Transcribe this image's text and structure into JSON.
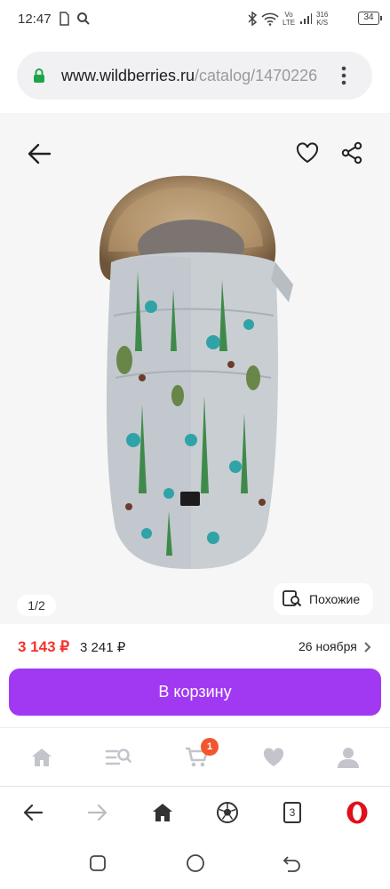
{
  "status_bar": {
    "time": "12:47",
    "network_label_top": "Vo",
    "network_label_bottom": "LTE",
    "speed_top": "316",
    "speed_bottom": "K/S",
    "battery": "34"
  },
  "browser": {
    "url_domain": "www.wildberries.ru",
    "url_path": "/catalog/1470226"
  },
  "product": {
    "image_counter": "1/2",
    "similar_label": "Похожие",
    "price_current": "3 143 ₽",
    "price_old": "3 241 ₽",
    "delivery_date": "26 ноября",
    "cart_button_label": "В корзину"
  },
  "app_nav": {
    "items": [
      "home-icon",
      "catalog-search-icon",
      "cart-icon",
      "heart-icon",
      "profile-icon"
    ],
    "cart_badge": "1"
  },
  "browser_toolbar": {
    "tabs_count": "3"
  },
  "colors": {
    "accent": "#a239f2",
    "price_red": "#f2332f",
    "badge": "#f2562f",
    "opera_red": "#e0101b"
  }
}
